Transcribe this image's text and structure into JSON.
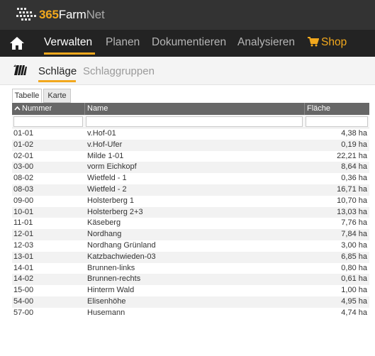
{
  "brand": {
    "num": "365",
    "name1": "Farm",
    "name2": "Net"
  },
  "nav": {
    "items": [
      {
        "label": "Verwalten",
        "active": true
      },
      {
        "label": "Planen",
        "active": false
      },
      {
        "label": "Dokumentieren",
        "active": false
      },
      {
        "label": "Analysieren",
        "active": false
      }
    ],
    "shop_label": "Shop"
  },
  "subnav": {
    "items": [
      {
        "label": "Schläge",
        "active": true
      },
      {
        "label": "Schlaggruppen",
        "active": false
      }
    ]
  },
  "view_tabs": [
    {
      "label": "Tabelle",
      "active": true
    },
    {
      "label": "Karte",
      "active": false
    }
  ],
  "table": {
    "sort_indicator": "^",
    "columns": [
      "Nummer",
      "Name",
      "Fläche"
    ],
    "filters": [
      "",
      "",
      ""
    ],
    "rows": [
      {
        "nummer": "01-01",
        "name": "v.Hof-01",
        "flaeche": "4,38 ha"
      },
      {
        "nummer": "01-02",
        "name": "v.Hof-Ufer",
        "flaeche": "0,19 ha"
      },
      {
        "nummer": "02-01",
        "name": "Milde 1-01",
        "flaeche": "22,21 ha"
      },
      {
        "nummer": "03-00",
        "name": "vorm Eichkopf",
        "flaeche": "8,64 ha"
      },
      {
        "nummer": "08-02",
        "name": "Wietfeld - 1",
        "flaeche": "0,36 ha"
      },
      {
        "nummer": "08-03",
        "name": "Wietfeld - 2",
        "flaeche": "16,71 ha"
      },
      {
        "nummer": "09-00",
        "name": "Holsterberg 1",
        "flaeche": "10,70 ha"
      },
      {
        "nummer": "10-01",
        "name": "Holsterberg 2+3",
        "flaeche": "13,03 ha"
      },
      {
        "nummer": "11-01",
        "name": "Käseberg",
        "flaeche": "7,76 ha"
      },
      {
        "nummer": "12-01",
        "name": "Nordhang",
        "flaeche": "7,84 ha"
      },
      {
        "nummer": "12-03",
        "name": "Nordhang Grünland",
        "flaeche": "3,00 ha"
      },
      {
        "nummer": "13-01",
        "name": "Katzbachwieden-03",
        "flaeche": "6,85 ha"
      },
      {
        "nummer": "14-01",
        "name": "Brunnen-links",
        "flaeche": "0,80 ha"
      },
      {
        "nummer": "14-02",
        "name": "Brunnen-rechts",
        "flaeche": "0,61 ha"
      },
      {
        "nummer": "15-00",
        "name": "Hinterm Wald",
        "flaeche": "1,00 ha"
      },
      {
        "nummer": "54-00",
        "name": "Elisenhöhe",
        "flaeche": "4,95 ha"
      },
      {
        "nummer": "57-00",
        "name": "Husemann",
        "flaeche": "4,74 ha"
      }
    ]
  },
  "colors": {
    "accent": "#f2a81d",
    "brandbar": "#333333",
    "navbar": "#232323",
    "table_header": "#676767"
  }
}
